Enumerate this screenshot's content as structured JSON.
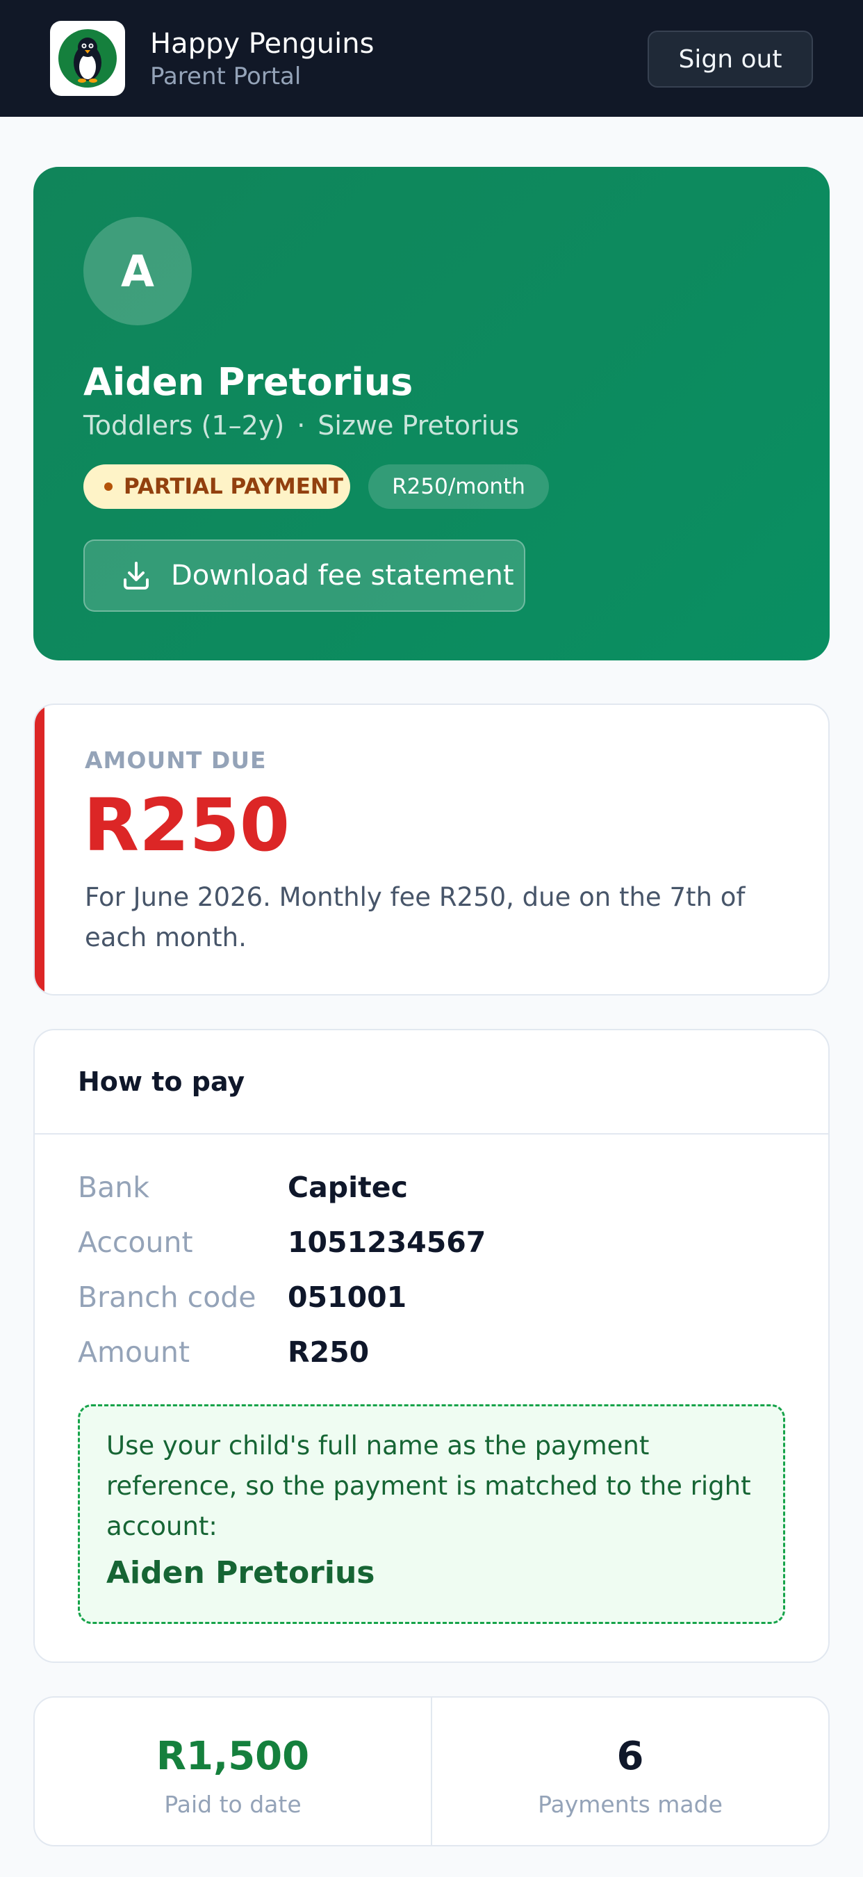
{
  "colors": {
    "header_bg": "#111827",
    "hero_green": "#0d8a5e",
    "due_red": "#dc2626",
    "paid_green": "#15803d",
    "partial_badge_bg": "#fef3c7",
    "partial_badge_text": "#92400e"
  },
  "header": {
    "logo_icon": "penguin-logo",
    "app_name": "Happy Penguins",
    "app_subtitle": "Parent Portal",
    "sign_out_label": "Sign out"
  },
  "child": {
    "avatar_initial": "A",
    "name": "Aiden Pretorius",
    "class_name": "Toddlers (1–2y)",
    "separator": "·",
    "parent_name": "Sizwe Pretorius",
    "status_badge": "PARTIAL PAYMENT",
    "fee_badge": "R250/month",
    "download_icon": "download-icon",
    "download_label": "Download fee statement"
  },
  "amount_due": {
    "label": "AMOUNT DUE",
    "amount": "R250",
    "note": "For June 2026. Monthly fee R250, due on the 7th of each month."
  },
  "how_to_pay": {
    "title": "How to pay",
    "rows": [
      {
        "label": "Bank",
        "value": "Capitec"
      },
      {
        "label": "Account",
        "value": "1051234567"
      },
      {
        "label": "Branch code",
        "value": "051001"
      },
      {
        "label": "Amount",
        "value": "R250"
      }
    ],
    "reference_text": "Use your child's full name as the payment reference, so the payment is matched to the right account:",
    "reference_name": "Aiden Pretorius"
  },
  "stats": [
    {
      "value": "R1,500",
      "label": "Paid to date"
    },
    {
      "value": "6",
      "label": "Payments made"
    }
  ]
}
